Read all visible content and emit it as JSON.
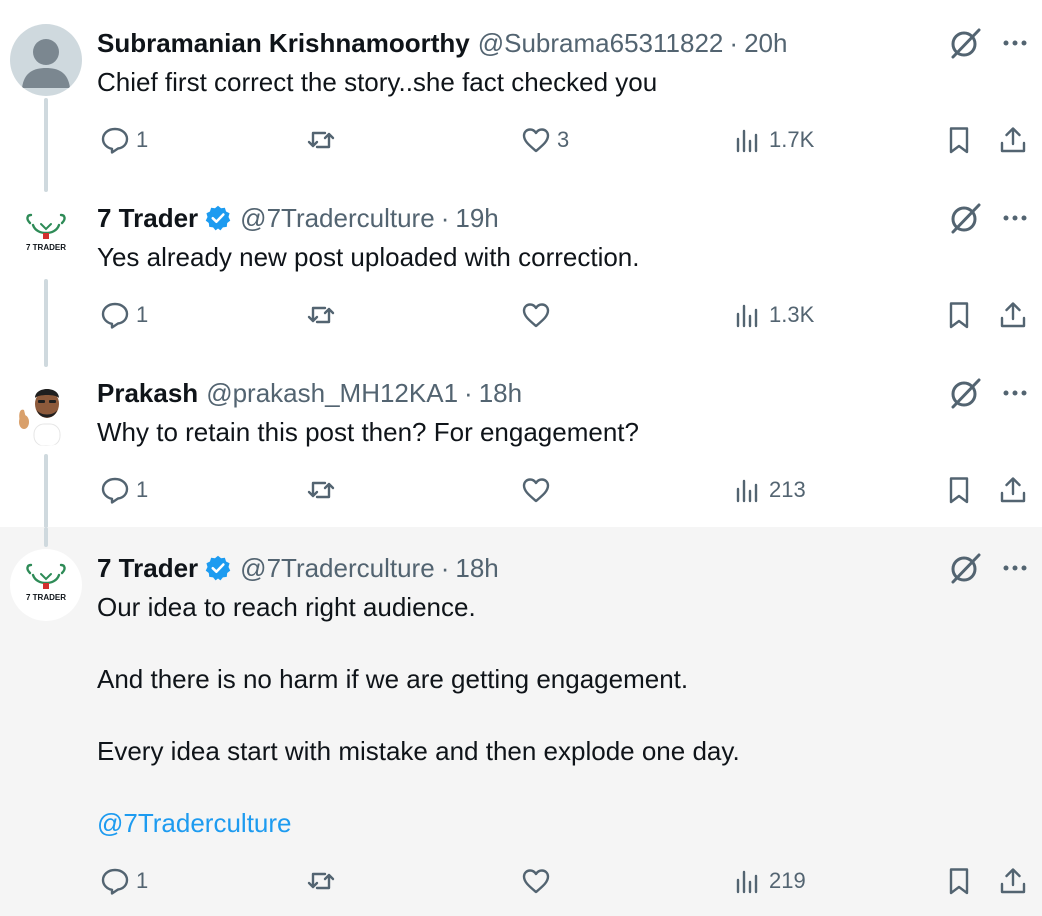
{
  "colors": {
    "text": "#0f1419",
    "secondary": "#536471",
    "link": "#1d9bf0",
    "highlight_bg": "#f5f5f5",
    "thread_line": "#cfd9de"
  },
  "tweets": [
    {
      "name": "Subramanian Krishnamoorthy",
      "handle": "@Subrama65311822",
      "dot": "·",
      "time": "20h",
      "verified": false,
      "avatar": "default-avatar",
      "text": [
        "Chief first correct the story..she fact checked you"
      ],
      "replies": "1",
      "retweets": "",
      "likes": "3",
      "views": "1.7K"
    },
    {
      "name": "7 Trader",
      "handle": "@7Traderculture",
      "dot": "·",
      "time": "19h",
      "verified": true,
      "avatar": "7trader-logo",
      "avatar_label": "7 TRADER",
      "text": [
        "Yes already new post uploaded with correction."
      ],
      "replies": "1",
      "retweets": "",
      "likes": "",
      "views": "1.3K"
    },
    {
      "name": "Prakash",
      "handle": "@prakash_MH12KA1",
      "dot": "·",
      "time": "18h",
      "verified": false,
      "avatar": "memoji-avatar",
      "text": [
        "Why to retain this post then? For engagement?"
      ],
      "replies": "1",
      "retweets": "",
      "likes": "",
      "views": "213"
    },
    {
      "name": "7 Trader",
      "handle": "@7Traderculture",
      "dot": "·",
      "time": "18h",
      "verified": true,
      "avatar": "7trader-logo",
      "avatar_label": "7 TRADER",
      "text": [
        "Our idea to reach right audience.",
        "And there is no harm if we are getting engagement.",
        "Every idea start with mistake and then explode one day."
      ],
      "mention": "@7Traderculture",
      "replies": "1",
      "retweets": "",
      "likes": "",
      "views": "219"
    }
  ],
  "icons": {
    "reply": "reply-icon",
    "retweet": "retweet-icon",
    "like": "heart-icon",
    "views": "views-icon",
    "bookmark": "bookmark-icon",
    "share": "share-icon",
    "grok": "grok-icon",
    "more": "more-icon"
  }
}
